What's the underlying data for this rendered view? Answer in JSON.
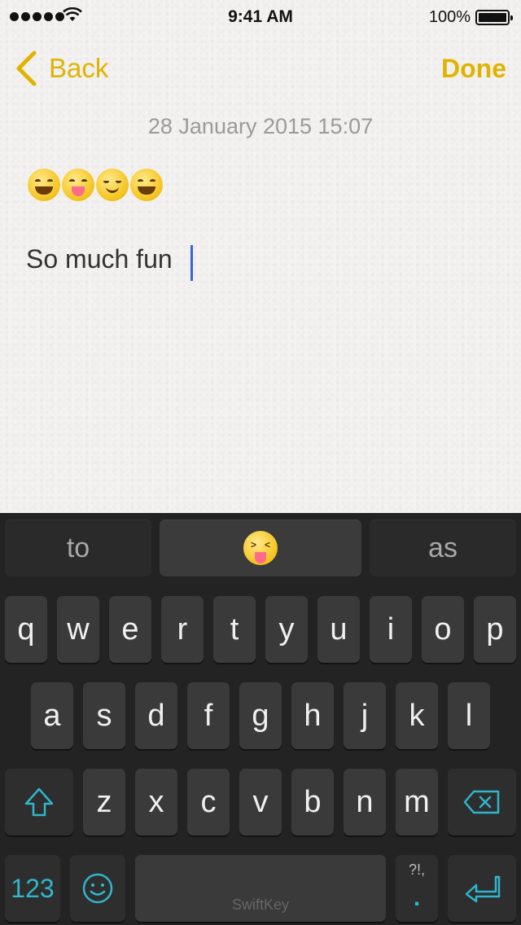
{
  "status_bar": {
    "time": "9:41 AM",
    "battery_percent": "100%",
    "signal_bars": 5
  },
  "nav": {
    "back_label": "Back",
    "done_label": "Done",
    "accent_color": "#e1b300"
  },
  "note": {
    "date": "28 January 2015 15:07",
    "text": "So much fun",
    "emoji_icons": [
      "grinning-face-icon",
      "winking-tongue-face-icon",
      "relieved-face-icon",
      "grinning-face-icon"
    ]
  },
  "keyboard": {
    "brand": "SwiftKey",
    "suggestions": [
      "to",
      "squinting-tongue-face-icon",
      "as"
    ],
    "row1": [
      "q",
      "w",
      "e",
      "r",
      "t",
      "y",
      "u",
      "i",
      "o",
      "p"
    ],
    "row2": [
      "a",
      "s",
      "d",
      "f",
      "g",
      "h",
      "j",
      "k",
      "l"
    ],
    "row3": [
      "z",
      "x",
      "c",
      "v",
      "b",
      "n",
      "m"
    ],
    "numbers_label": "123",
    "punct_top": "?!,",
    "punct_bottom": ".",
    "accent_color": "#2fb6cc"
  }
}
